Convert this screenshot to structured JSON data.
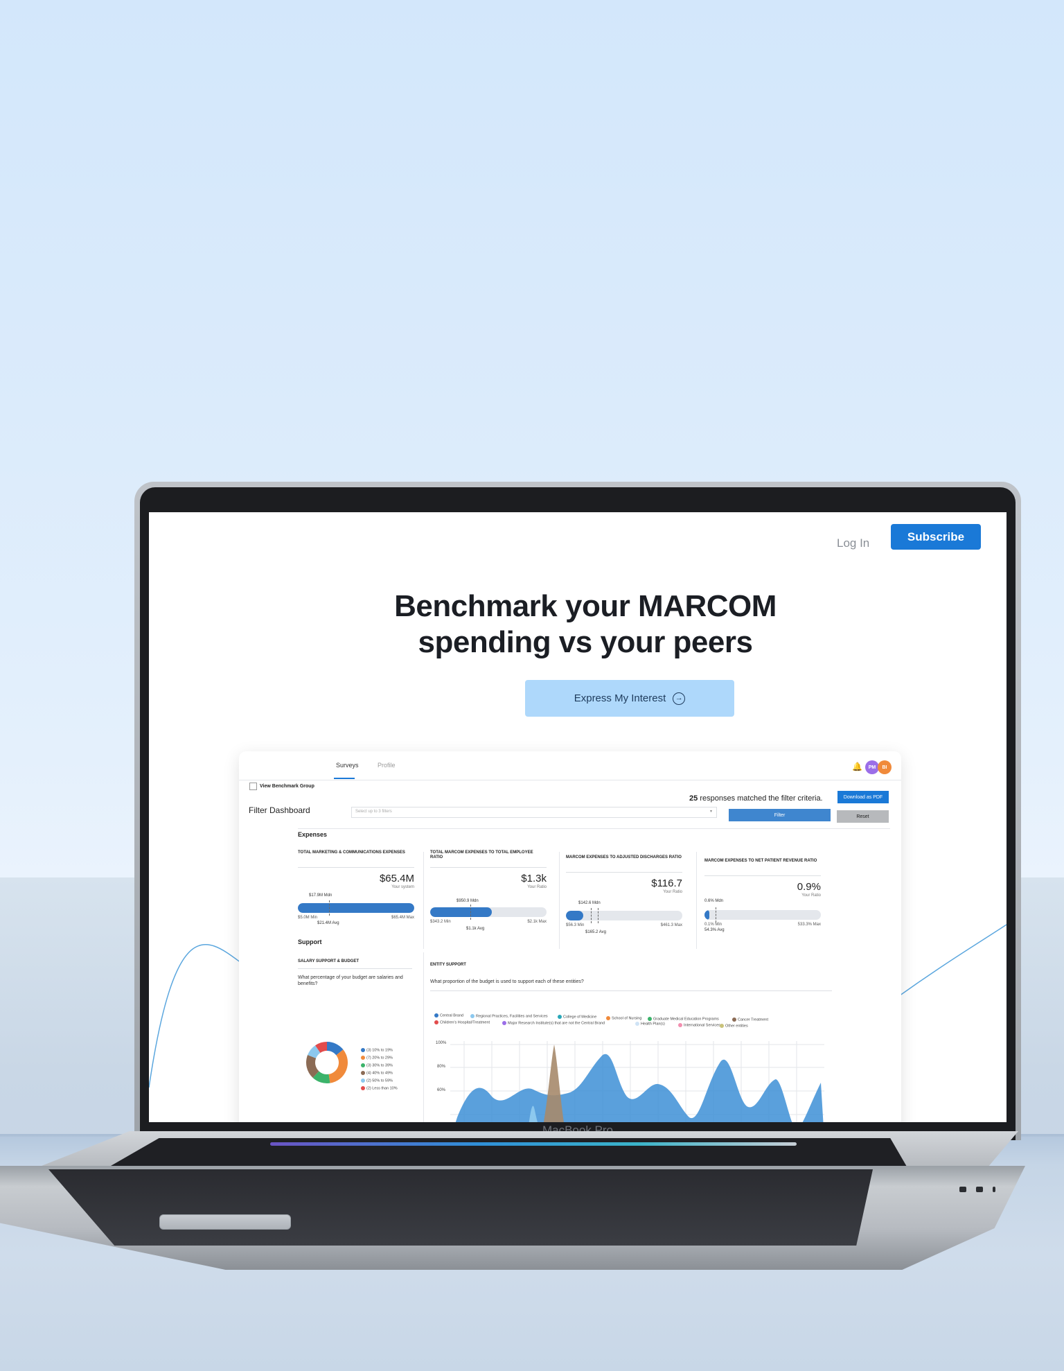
{
  "device": {
    "label": "MacBook Pro"
  },
  "nav": {
    "login": "Log In",
    "subscribe": "Subscribe"
  },
  "hero": {
    "line1": "Benchmark your MARCOM",
    "line2": "spending vs your peers",
    "cta": "Express My Interest"
  },
  "dashboard": {
    "tabs": [
      "Surveys",
      "Profile"
    ],
    "avatars": [
      {
        "initials": "PM",
        "color": "#9b6ee8"
      },
      {
        "initials": "BI",
        "color": "#f08a3b"
      }
    ],
    "benchmark_label": "View Benchmark Group",
    "responses_count": "25",
    "responses_text": "responses matched the filter criteria.",
    "download_pdf": "Download as PDF",
    "filter_title": "Filter Dashboard",
    "filter_placeholder": "Select up to 3 filters",
    "filter_button": "Filter",
    "reset_button": "Reset",
    "section_expenses": "Expenses",
    "section_support": "Support",
    "metrics": [
      {
        "title": "TOTAL MARKETING & COMMUNICATIONS EXPENSES",
        "value": "$65.4M",
        "sub": "Your system",
        "median": "$17.9M Mdn",
        "min": "$5.0M Min",
        "max": "$65.4M Max",
        "avg": "$21.4M Avg",
        "fill": 1.0
      },
      {
        "title": "TOTAL MARCOM EXPENSES TO TOTAL EMPLOYEE RATIO",
        "value": "$1.3k",
        "sub": "Your Ratio",
        "median": "$950.9 Mdn",
        "min": "$343.2 Min",
        "max": "$2.1k Max",
        "avg": "$1.1k Avg",
        "fill": 0.53
      },
      {
        "title": "MARCOM EXPENSES TO ADJUSTED DISCHARGES RATIO",
        "value": "$116.7",
        "sub": "Your Ratio",
        "median": "$142.6 Mdn",
        "min": "$56.3 Min",
        "max": "$461.3 Max",
        "avg": "$165.2 Avg",
        "fill": 0.15
      },
      {
        "title": "MARCOM EXPENSES TO NET PATIENT REVENUE RATIO",
        "value": "0.9%",
        "sub": "Your Ratio",
        "median": "0.6% Mdn",
        "min": "0.1% Min",
        "max": "533.3% Max",
        "avg": "54.3% Avg",
        "fill": 0.01
      }
    ],
    "salary": {
      "title": "SALARY SUPPORT & BUDGET",
      "question": "What percentage of your budget are salaries and benefits?",
      "legend": [
        {
          "label": "(3) 10% to 19%",
          "color": "#3479c6"
        },
        {
          "label": "(7) 20% to 29%",
          "color": "#f08a3b"
        },
        {
          "label": "(3) 30% to 39%",
          "color": "#3bb36a"
        },
        {
          "label": "(4) 40% to 49%",
          "color": "#8b6b55"
        },
        {
          "label": "(2) 50% to 59%",
          "color": "#8cc8ee"
        },
        {
          "label": "(2) Less than 10%",
          "color": "#e24b4b"
        }
      ]
    },
    "entity": {
      "title": "ENTITY SUPPORT",
      "question": "What proportion of the budget is used to support each of these entities?",
      "legend": [
        {
          "label": "Central Brand",
          "color": "#3479c6"
        },
        {
          "label": "Regional Practices, Facilities and Services",
          "color": "#8cc8ee"
        },
        {
          "label": "College of Medicine",
          "color": "#29a7b8"
        },
        {
          "label": "School of Nursing",
          "color": "#f08a3b"
        },
        {
          "label": "Graduate Medical Education Programs",
          "color": "#3bb36a"
        },
        {
          "label": "Cancer Treatment",
          "color": "#8b6b55"
        },
        {
          "label": "Children's Hospital/Treatment",
          "color": "#e24b4b"
        },
        {
          "label": "Major Research Institute(s) that are not the Central Brand",
          "color": "#9b6ee8"
        },
        {
          "label": "Health Plan(s)",
          "color": "#cfe3f5"
        },
        {
          "label": "International Services",
          "color": "#f28fb0"
        },
        {
          "label": "Other entities",
          "color": "#c9c27a"
        }
      ],
      "y_ticks": [
        "100%",
        "80%",
        "60%"
      ]
    }
  }
}
